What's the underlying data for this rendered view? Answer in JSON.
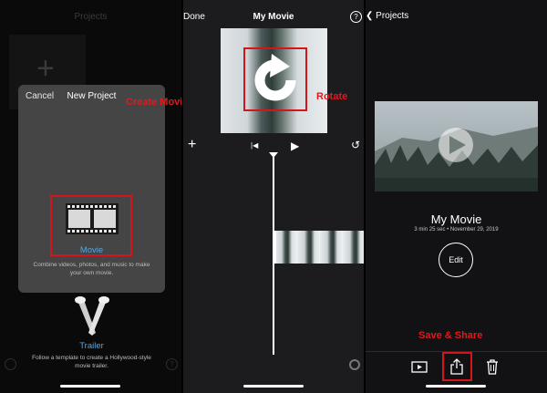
{
  "colors": {
    "annotation_red": "#d4161b",
    "link_blue": "#56a6e0"
  },
  "panel1": {
    "header_title": "Projects",
    "dialog": {
      "cancel_label": "Cancel",
      "title": "New Project",
      "movie_label": "Movie",
      "movie_description": "Combine videos, photos, and music to make your own movie.",
      "trailer_label": "Trailer",
      "trailer_description": "Follow a template to create a Hollywood-style movie trailer."
    },
    "annotation": "Create Movie",
    "help_glyph": "?"
  },
  "panel2": {
    "done_label": "Done",
    "title": "My Movie",
    "help_glyph": "?",
    "annotation": "Rotate",
    "toolbar": {
      "add_glyph": "+",
      "skip_glyph": "|◀",
      "play_glyph": "▶",
      "undo_glyph": "↺"
    }
  },
  "panel3": {
    "back_label": "Projects",
    "movie_title": "My Movie",
    "meta": "3 min 25 sec • November 29, 2019",
    "edit_label": "Edit",
    "annotation": "Save & Share",
    "icons": [
      "play-preview-icon",
      "share-icon",
      "trash-icon"
    ]
  }
}
